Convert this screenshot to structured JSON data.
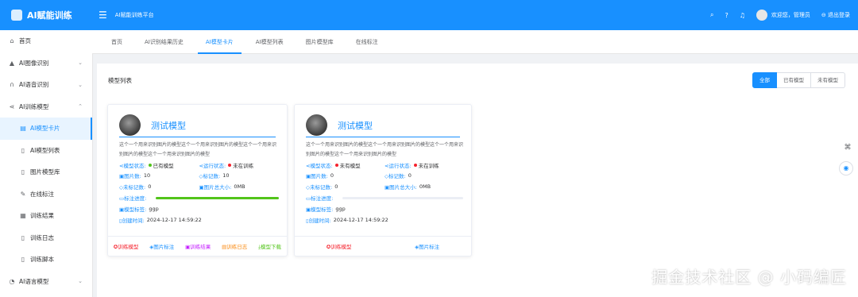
{
  "app": {
    "logo_text": "AI赋能训练",
    "header_title": "AI赋能训练平台"
  },
  "header": {
    "greeting": "欢迎您，管理员",
    "logout": "退出登录"
  },
  "sidebar": [
    {
      "label": "首页",
      "icon": "home-icon",
      "glyph": "⌂"
    },
    {
      "label": "AI图像识别",
      "icon": "image-icon",
      "glyph": "▲",
      "caret": "⌄"
    },
    {
      "label": "AI语音识别",
      "icon": "headphone-icon",
      "glyph": "∩",
      "caret": "⌄"
    },
    {
      "label": "AI训练模型",
      "icon": "share-icon",
      "glyph": "⋖",
      "caret": "⌃",
      "open": true
    },
    {
      "label": "AI模型卡片",
      "icon": "card-icon",
      "glyph": "▤",
      "sub": true,
      "active": true
    },
    {
      "label": "AI模型列表",
      "icon": "doc-icon",
      "glyph": "▯",
      "sub": true
    },
    {
      "label": "图片模型库",
      "icon": "doc-icon",
      "glyph": "▯",
      "sub": true
    },
    {
      "label": "在线标注",
      "icon": "edit-icon",
      "glyph": "✎",
      "sub": true
    },
    {
      "label": "训练结果",
      "icon": "table-icon",
      "glyph": "▦",
      "sub": true
    },
    {
      "label": "训练日志",
      "icon": "log-icon",
      "glyph": "▯",
      "sub": true
    },
    {
      "label": "训练脚本",
      "icon": "script-icon",
      "glyph": "▯",
      "sub": true
    },
    {
      "label": "AI语言模型",
      "icon": "chat-icon",
      "glyph": "◔",
      "caret": "⌄"
    }
  ],
  "tabs": [
    "首页",
    "AI识别结果历史",
    "AI模型卡片",
    "AI模型列表",
    "图片模型库",
    "在线标注"
  ],
  "active_tab": 2,
  "panel": {
    "title": "模型列表",
    "filters": [
      "全部",
      "已有模型",
      "未有模型"
    ],
    "active_filter": 0
  },
  "cards": [
    {
      "name": "测试模型",
      "desc": "这个一个用来识别图片的模型这个一个用来识别图片的模型这个一个用来识别图片的模型这个一个用来识别图片的模型",
      "model_status_label": "模型状态:",
      "model_status": "已有模型",
      "model_status_color": "#52c41a",
      "run_status_label": "运行状态:",
      "run_status": "未在训练",
      "run_status_color": "#f5222d",
      "images_label": "图片数:",
      "images": "10",
      "labeled_label": "标记数:",
      "labeled": "10",
      "unlabeled_label": "未标记数:",
      "unlabeled": "0",
      "size_label": "图片总大小:",
      "size": "0MB",
      "progress_label": "标注进度:",
      "progress": 1.0,
      "tag_label": "模型标签:",
      "tag": "ggp",
      "created_label": "创建时间:",
      "created": "2024-12-17 14:59:22",
      "actions": [
        {
          "label": "训练模型",
          "color": "#f5222d",
          "icon": "fire-icon",
          "glyph": "✪"
        },
        {
          "label": "图片标注",
          "color": "#1890ff",
          "icon": "tag-icon",
          "glyph": "◈"
        },
        {
          "label": "训练结果",
          "color": "#c41dff",
          "icon": "result-icon",
          "glyph": "▣"
        },
        {
          "label": "训练日志",
          "color": "#fa8c16",
          "icon": "log-icon",
          "glyph": "▤"
        },
        {
          "label": "模型下载",
          "color": "#52c41a",
          "icon": "download-icon",
          "glyph": "⤓"
        }
      ]
    },
    {
      "name": "测试模型",
      "desc": "这个一个用来识别图片的模型这个一个用来识别图片的模型这个一个用来识别图片的模型这个一个用来识别图片的模型",
      "model_status_label": "模型状态:",
      "model_status": "未有模型",
      "model_status_color": "#f5222d",
      "run_status_label": "运行状态:",
      "run_status": "未在训练",
      "run_status_color": "#f5222d",
      "images_label": "图片数:",
      "images": "0",
      "labeled_label": "标记数:",
      "labeled": "0",
      "unlabeled_label": "未标记数:",
      "unlabeled": "0",
      "size_label": "图片总大小:",
      "size": "0MB",
      "progress_label": "标注进度:",
      "progress": 0.0,
      "tag_label": "模型标签:",
      "tag": "ggp",
      "created_label": "创建时间:",
      "created": "2024-12-17 14:59:22",
      "actions": [
        {
          "label": "训练模型",
          "color": "#f5222d",
          "icon": "fire-icon",
          "glyph": "✪"
        },
        {
          "label": "图片标注",
          "color": "#1890ff",
          "icon": "tag-icon",
          "glyph": "◈"
        }
      ]
    }
  ],
  "watermark": "掘金技术社区 @ 小码编匠"
}
